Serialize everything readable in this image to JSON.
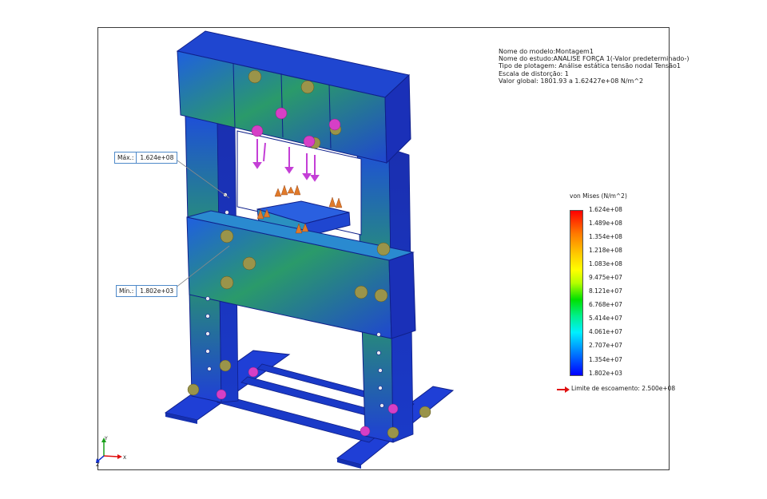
{
  "info": {
    "model_name": "Nome do modelo:Montagem1",
    "study_name": "Nome do estudo:ANALISE FORÇA 1(-Valor predeterminado-)",
    "plot_type": "Tipo de plotagem: Análise estática tensão nodal Tensão1",
    "distortion": "Escala de distorção: 1",
    "global_value": "Valor global: 1801.93 a 1.62427e+08 N/m^2"
  },
  "callouts": {
    "max": {
      "label": "Máx.:",
      "value": "1.624e+08"
    },
    "min": {
      "label": "Mín.:",
      "value": "1.802e+03"
    }
  },
  "legend": {
    "title": "von Mises (N/m^2)",
    "ticks": [
      "1.624e+08",
      "1.489e+08",
      "1.354e+08",
      "1.218e+08",
      "1.083e+08",
      "9.475e+07",
      "8.121e+07",
      "6.768e+07",
      "5.414e+07",
      "4.061e+07",
      "2.707e+07",
      "1.354e+07",
      "1.802e+03"
    ],
    "yield_label": "Limite de escoamento: 2.500e+08"
  },
  "colors": {
    "frame_blue": "#1f3fd6",
    "mid_green": "#2aa84a",
    "bolt_olive": "#8a8a3a",
    "bolt_magenta": "#d63fc6",
    "load_orange": "#e07a2a",
    "yield_arrow": "#e01010"
  },
  "triad": {
    "x": "X",
    "y": "Y",
    "z": "Z"
  }
}
